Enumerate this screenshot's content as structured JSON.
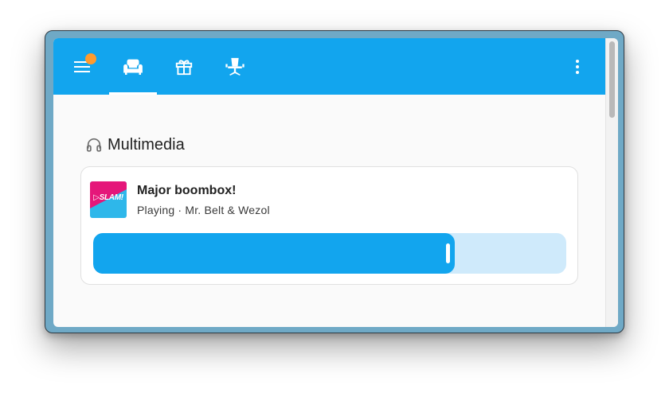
{
  "topbar": {
    "menu_icon": "hamburger-menu-icon",
    "notification_badge": true,
    "tabs": [
      {
        "icon": "sofa-icon",
        "active": true
      },
      {
        "icon": "gift-icon",
        "active": false
      },
      {
        "icon": "office-chair-icon",
        "active": false
      }
    ],
    "more_icon": "dots-vertical-icon"
  },
  "section": {
    "icon": "headphones-icon",
    "title": "Multimedia"
  },
  "media": {
    "art_logo": "▷SLAM!",
    "title": "Major boombox!",
    "status": "Playing · Mr. Belt & Wezol",
    "progress": 0.765
  },
  "colors": {
    "accent": "#12a5ee",
    "track": "#cfeafb",
    "badge": "#ff9b2e",
    "art_top": "#e5177a",
    "art_bottom": "#2eb7ea"
  }
}
